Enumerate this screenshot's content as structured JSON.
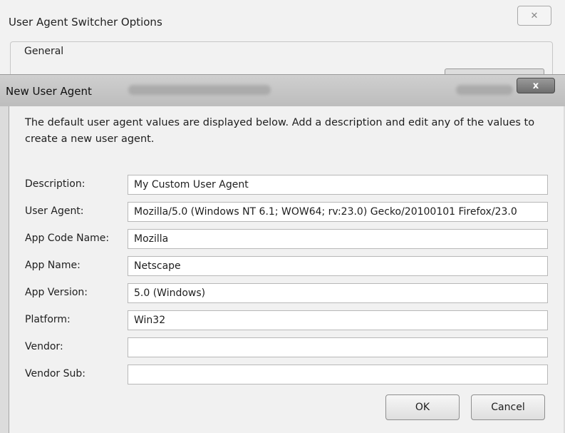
{
  "background_dialog": {
    "title": "User Agent Switcher Options",
    "close_label": "✕",
    "group_label": "General"
  },
  "dialog": {
    "title": "New User Agent",
    "close_label": "x",
    "intro": "The default user agent values are displayed below. Add a description and edit any of the values to create a new user agent.",
    "fields": [
      {
        "label": "Description:",
        "value": "My Custom User Agent"
      },
      {
        "label": "User Agent:",
        "value": "Mozilla/5.0 (Windows NT 6.1; WOW64; rv:23.0) Gecko/20100101 Firefox/23.0"
      },
      {
        "label": "App Code Name:",
        "value": "Mozilla"
      },
      {
        "label": "App Name:",
        "value": "Netscape"
      },
      {
        "label": "App Version:",
        "value": "5.0 (Windows)"
      },
      {
        "label": "Platform:",
        "value": "Win32"
      },
      {
        "label": "Vendor:",
        "value": ""
      },
      {
        "label": "Vendor Sub:",
        "value": ""
      }
    ],
    "ok_label": "OK",
    "cancel_label": "Cancel"
  }
}
